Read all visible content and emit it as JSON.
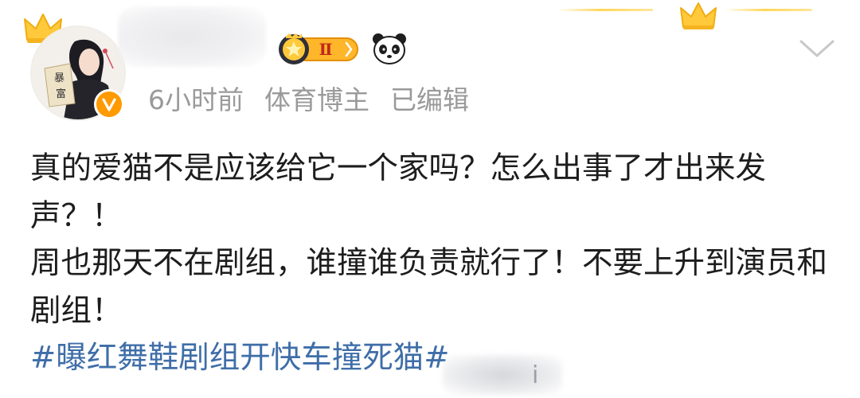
{
  "post": {
    "meta": {
      "time": "6小时前",
      "role": "体育博主",
      "status": "已编辑"
    },
    "paragraphs": [
      "真的爱猫不是应该给它一个家吗？怎么出事了才出来发声？！",
      "周也那天不在剧组，谁撞谁负责就行了！不要上升到演员和剧组！"
    ],
    "hashtag": "#曝红舞鞋剧组开快车撞死猫#"
  },
  "badges": {
    "level": "Ⅱ"
  },
  "avatar": {
    "text": "暴富"
  },
  "watermark": {
    "mark": "i"
  },
  "colors": {
    "meta_text": "#9a9a9a",
    "body_text": "#1d1d1d",
    "hashtag": "#3f6ea8",
    "verified": "#ff9a00",
    "gold": "#ffc93b"
  },
  "icons": [
    "crown-icon",
    "verified-icon",
    "level-badge-icon",
    "panda-icon",
    "chevron-down-icon"
  ]
}
